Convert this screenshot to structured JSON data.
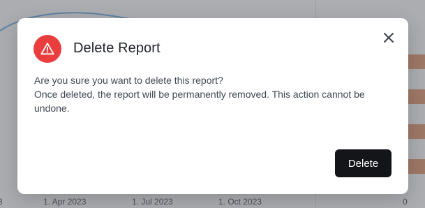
{
  "background": {
    "x_axis_labels": [
      "3",
      "1. Apr 2023",
      "1. Jul 2023",
      "1. Oct 2023"
    ],
    "side_axis_label": "0"
  },
  "dialog": {
    "title": "Delete Report",
    "message_line1": "Are you sure you want to delete this report?",
    "message_line2": "Once deleted, the report will be permanently removed. This action cannot be undone.",
    "delete_label": "Delete",
    "icon": "warning-icon",
    "close_icon": "close-icon"
  },
  "colors": {
    "danger": "#ea3d3d",
    "primary_button": "#141518",
    "overlay": "rgba(55, 60, 68, 0.42)"
  }
}
